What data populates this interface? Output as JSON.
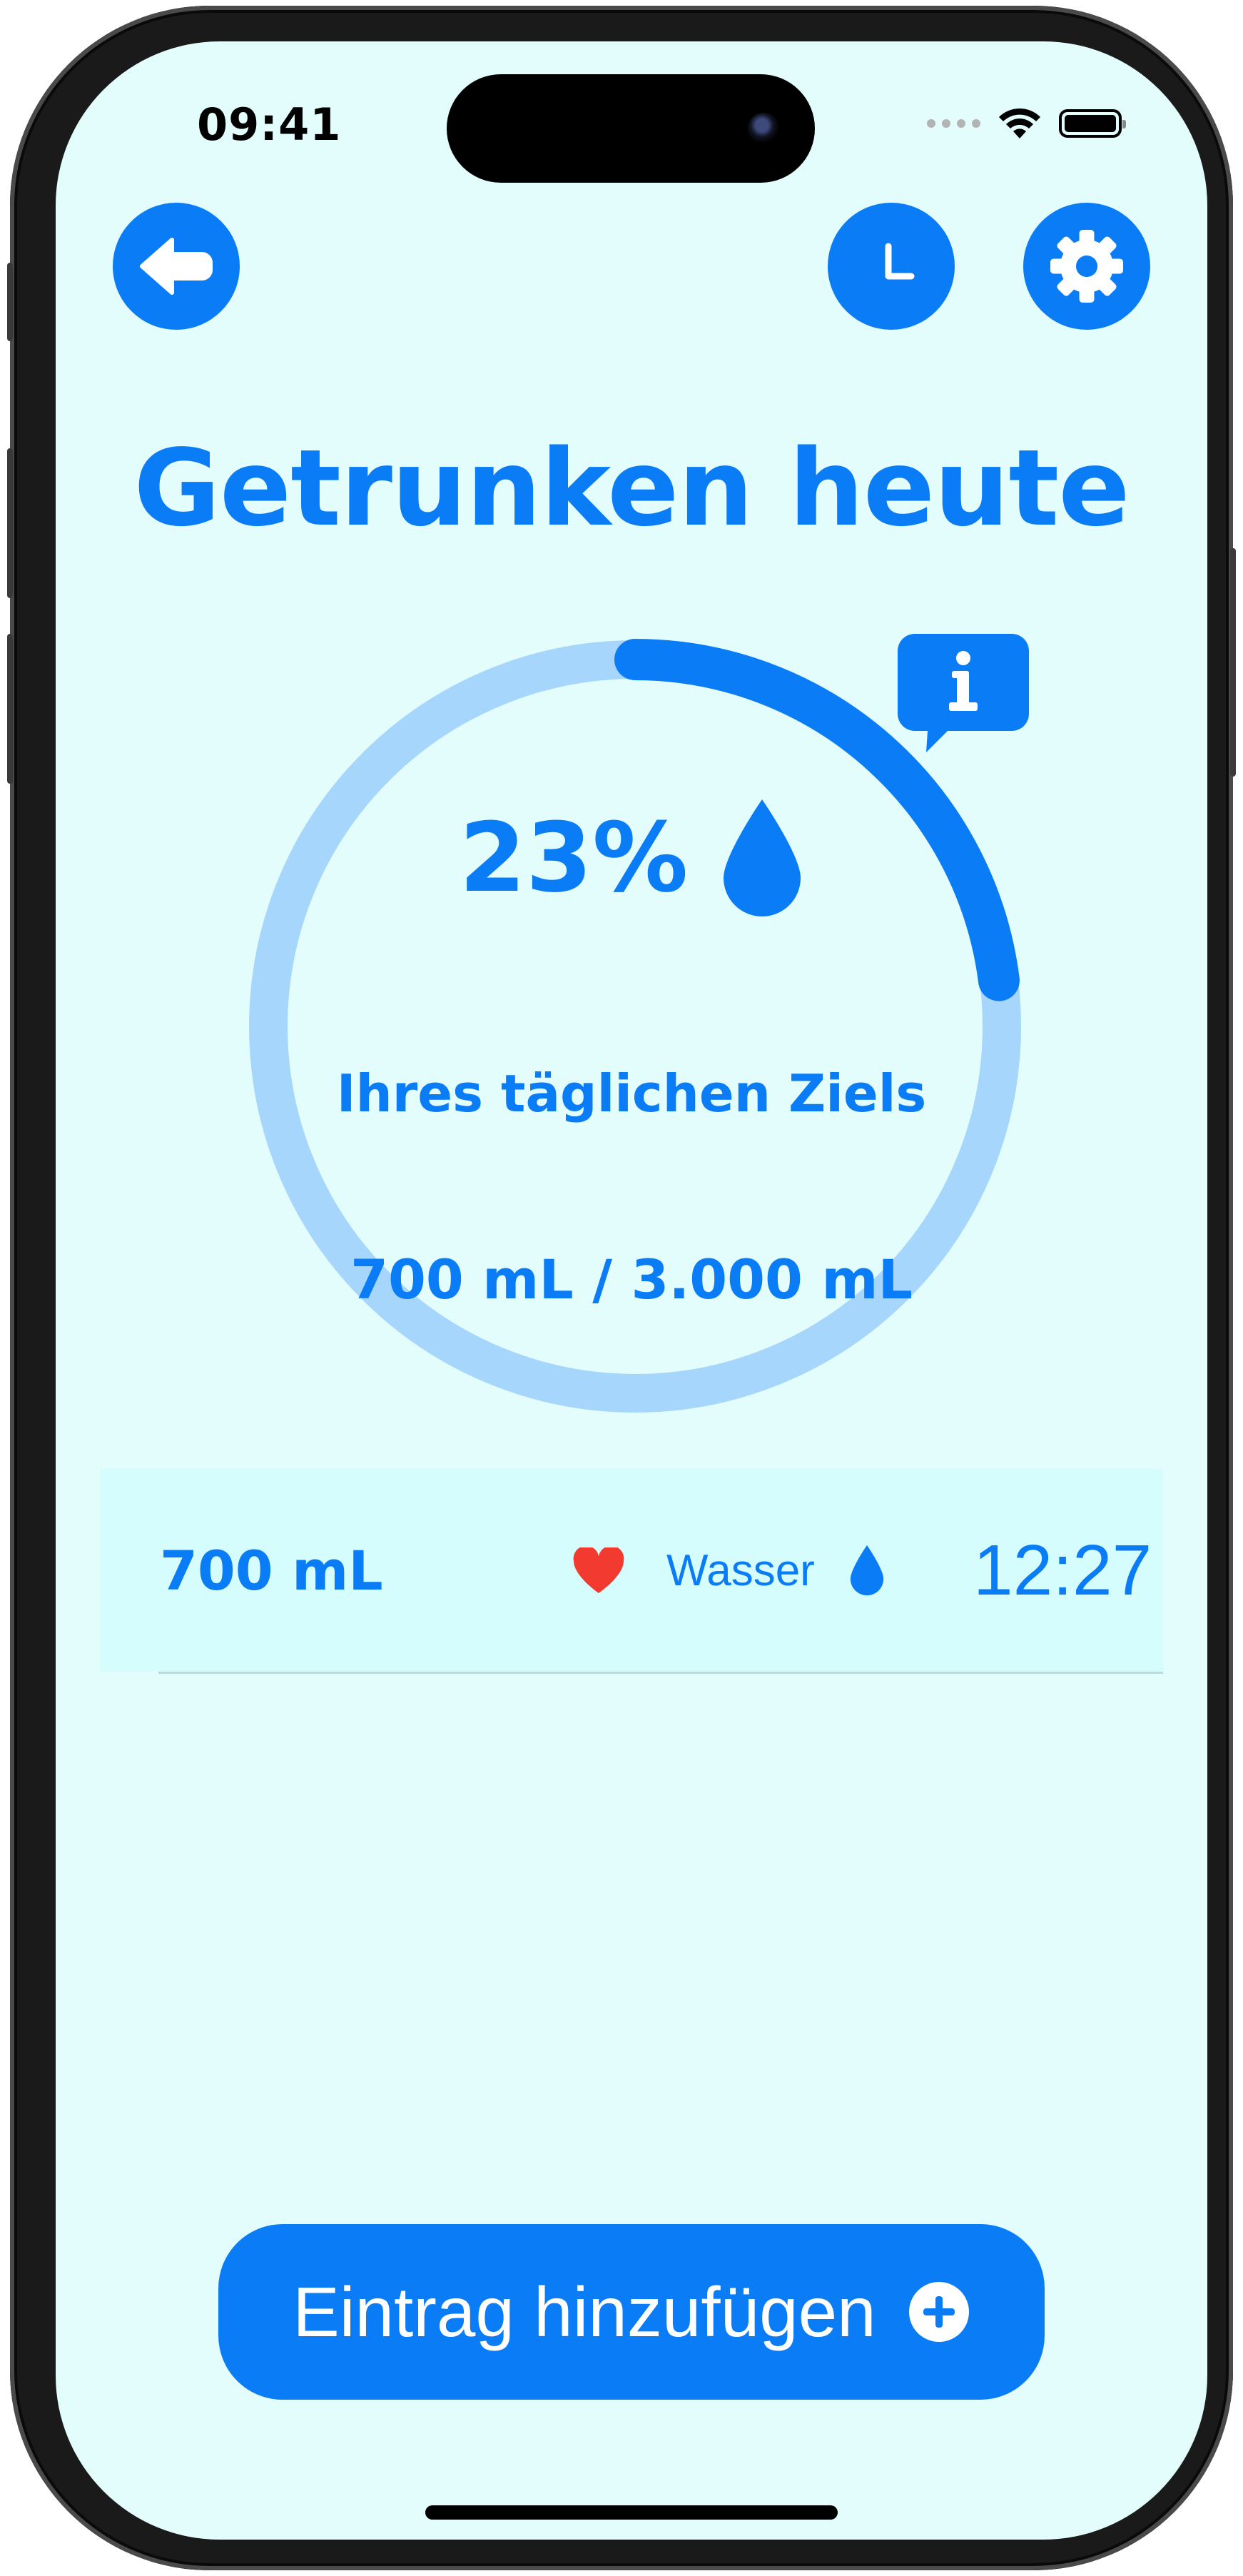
{
  "status_bar": {
    "time": "09:41"
  },
  "toolbar": {
    "back_icon": "arrow-left-icon",
    "history_icon": "clock-icon",
    "settings_icon": "gear-icon"
  },
  "main": {
    "title": "Getrunken heute",
    "progress_percent_label": "23%",
    "progress_fraction": 0.23,
    "goal_label": "Ihres täglichen Ziels",
    "amount_label": "700 mL / 3.000 mL"
  },
  "entries": [
    {
      "amount": "700 mL",
      "favorite_icon": "heart-icon",
      "type": "Wasser",
      "type_icon": "water-drop-icon",
      "time": "12:27"
    }
  ],
  "add_button": {
    "label": "Eintrag hinzufügen",
    "icon": "plus-circle-icon"
  },
  "colors": {
    "accent": "#0a7cf5",
    "ring_track": "#a6d6fb",
    "background": "#e3fcfc",
    "row_background": "#d6fdfd",
    "heart": "#f23a31"
  }
}
